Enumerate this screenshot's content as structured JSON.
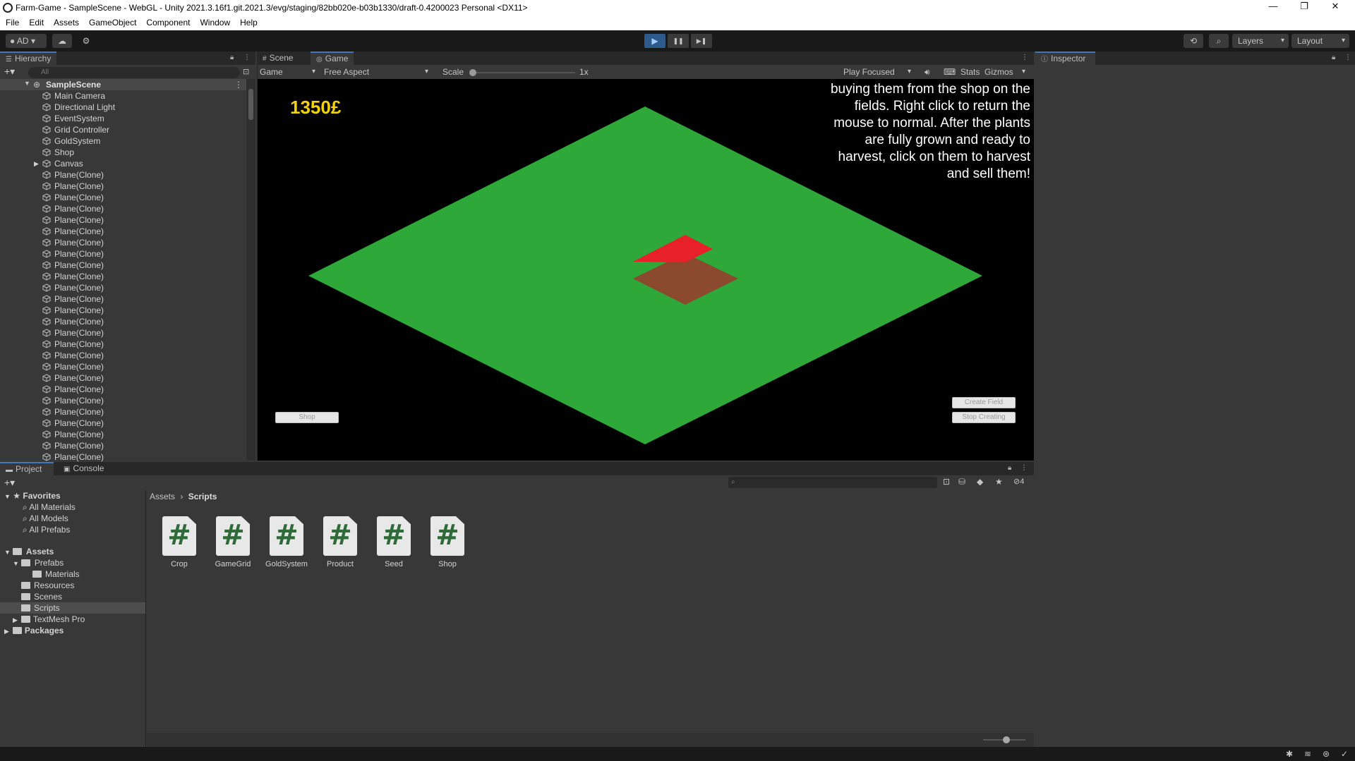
{
  "window": {
    "title": "Farm-Game - SampleScene - WebGL - Unity 2021.3.16f1.git.2021.3/evg/staging/82bb020e-b03b1330/draft-0.4200023 Personal <DX11>",
    "minimize": "—",
    "maximize": "❐",
    "close": "✕"
  },
  "menu": [
    "File",
    "Edit",
    "Assets",
    "GameObject",
    "Component",
    "Window",
    "Help"
  ],
  "toolbar": {
    "account": "AD",
    "layers": "Layers",
    "layout": "Layout",
    "play": "▶",
    "pause": "❚❚",
    "step": "▶❚"
  },
  "hierarchy": {
    "tab": "Hierarchy",
    "search_placeholder": "All",
    "scene": "SampleScene",
    "items": [
      "Main Camera",
      "Directional Light",
      "EventSystem",
      "Grid Controller",
      "GoldSystem",
      "Shop",
      "Canvas",
      "Plane(Clone)",
      "Plane(Clone)",
      "Plane(Clone)",
      "Plane(Clone)",
      "Plane(Clone)",
      "Plane(Clone)",
      "Plane(Clone)",
      "Plane(Clone)",
      "Plane(Clone)",
      "Plane(Clone)",
      "Plane(Clone)",
      "Plane(Clone)",
      "Plane(Clone)",
      "Plane(Clone)",
      "Plane(Clone)",
      "Plane(Clone)",
      "Plane(Clone)",
      "Plane(Clone)",
      "Plane(Clone)",
      "Plane(Clone)",
      "Plane(Clone)",
      "Plane(Clone)",
      "Plane(Clone)",
      "Plane(Clone)",
      "Plane(Clone)",
      "Plane(Clone)"
    ]
  },
  "scene_tabs": {
    "scene": "Scene",
    "game": "Game"
  },
  "game_toolbar": {
    "display": "Game",
    "aspect": "Free Aspect",
    "scale_label": "Scale",
    "scale_value": "1x",
    "play_mode": "Play Focused",
    "stats": "Stats",
    "gizmos": "Gizmos"
  },
  "game": {
    "gold": "1350£",
    "instructions": "buying them from the shop on the fields. Right click to return the mouse to normal. After the plants are fully grown and ready to harvest, click on them to harvest and sell them!",
    "shop_button": "Shop",
    "create_field_button": "Create Field",
    "stop_creating_button": "Stop Creating",
    "colors": {
      "ground": "#2fa83a",
      "field": "#8b4a2e",
      "highlight": "#e8202a"
    }
  },
  "inspector": {
    "tab": "Inspector"
  },
  "project": {
    "tab_project": "Project",
    "tab_console": "Console",
    "favorites": "Favorites",
    "favorite_items": [
      "All Materials",
      "All Models",
      "All Prefabs"
    ],
    "assets": "Assets",
    "asset_tree": [
      "Prefabs",
      "Materials",
      "Resources",
      "Scenes",
      "Scripts",
      "TextMesh Pro"
    ],
    "packages": "Packages",
    "breadcrumb": [
      "Assets",
      "Scripts"
    ],
    "hidden_count": "4",
    "scripts": [
      "Crop",
      "GameGrid",
      "GoldSystem",
      "Product",
      "Seed",
      "Shop"
    ]
  }
}
